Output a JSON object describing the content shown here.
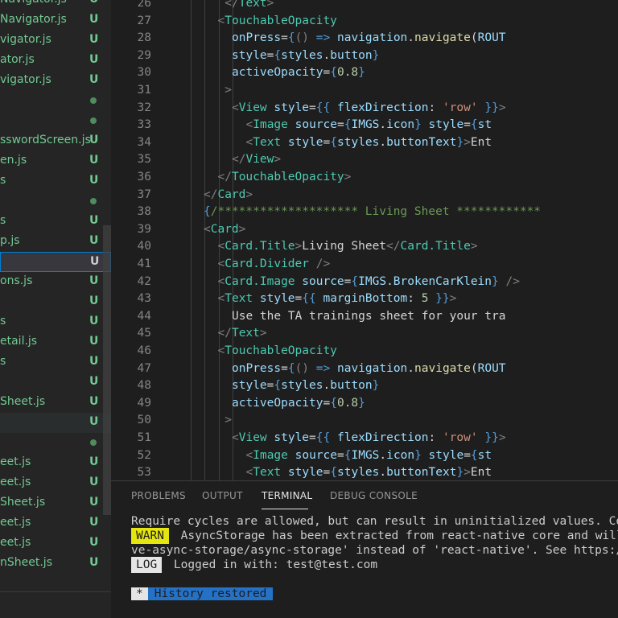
{
  "sidebar": {
    "files": [
      {
        "name": "Navigator.js",
        "badge": "U",
        "tail": "s"
      },
      {
        "name": "Navigator.js",
        "badge": "U"
      },
      {
        "name": "vigator.js",
        "badge": "U"
      },
      {
        "name": "ator.js",
        "badge": "U"
      },
      {
        "name": "vigator.js",
        "badge": "U"
      },
      {
        "name": "",
        "badge": "dot"
      },
      {
        "name": "",
        "badge": "dot"
      },
      {
        "name": "sswordScreen.js",
        "badge": "U"
      },
      {
        "name": "en.js",
        "badge": "U"
      },
      {
        "name": "s",
        "badge": "U"
      },
      {
        "name": "",
        "badge": "dot"
      },
      {
        "name": "s",
        "badge": "U"
      },
      {
        "name": "p.js",
        "badge": "U"
      },
      {
        "name": "",
        "badge": "U",
        "selected": true
      },
      {
        "name": "ons.js",
        "badge": "U"
      },
      {
        "name": "",
        "badge": "U"
      },
      {
        "name": "s",
        "badge": "U"
      },
      {
        "name": "etail.js",
        "badge": "U"
      },
      {
        "name": "s",
        "badge": "U"
      },
      {
        "name": "",
        "badge": "U"
      },
      {
        "name": "Sheet.js",
        "badge": "U"
      },
      {
        "name": "",
        "badge": "U",
        "hover": true
      },
      {
        "name": "",
        "badge": "dot"
      },
      {
        "name": "eet.js",
        "badge": "U"
      },
      {
        "name": "eet.js",
        "badge": "U"
      },
      {
        "name": "Sheet.js",
        "badge": "U"
      },
      {
        "name": "eet.js",
        "badge": "U"
      },
      {
        "name": "eet.js",
        "badge": "U"
      },
      {
        "name": "nSheet.js",
        "badge": "U"
      }
    ]
  },
  "editor": {
    "lines": [
      {
        "n": "26",
        "indent": 7,
        "tokens": [
          [
            "punc",
            "</"
          ],
          [
            "tag",
            "Text"
          ],
          [
            "punc",
            ">"
          ]
        ]
      },
      {
        "n": "27",
        "indent": 6,
        "tokens": [
          [
            "punc",
            "<"
          ],
          [
            "tag",
            "TouchableOpacity"
          ]
        ]
      },
      {
        "n": "28",
        "indent": 8,
        "tokens": [
          [
            "attr",
            "onPress"
          ],
          [
            "text",
            "="
          ],
          [
            "brace",
            "{"
          ],
          [
            "punc",
            "() "
          ],
          [
            "kw",
            "=>"
          ],
          [
            "text",
            " "
          ],
          [
            "attr",
            "navigation"
          ],
          [
            "text",
            "."
          ],
          [
            "fn",
            "navigate"
          ],
          [
            "text",
            "("
          ],
          [
            "attr",
            "ROUT"
          ]
        ]
      },
      {
        "n": "29",
        "indent": 8,
        "tokens": [
          [
            "attr",
            "style"
          ],
          [
            "text",
            "="
          ],
          [
            "brace",
            "{"
          ],
          [
            "attr",
            "styles"
          ],
          [
            "text",
            "."
          ],
          [
            "attr",
            "button"
          ],
          [
            "brace",
            "}"
          ]
        ]
      },
      {
        "n": "30",
        "indent": 8,
        "tokens": [
          [
            "attr",
            "activeOpacity"
          ],
          [
            "text",
            "="
          ],
          [
            "brace",
            "{"
          ],
          [
            "num",
            "0.8"
          ],
          [
            "brace",
            "}"
          ]
        ]
      },
      {
        "n": "31",
        "indent": 7,
        "tokens": [
          [
            "punc",
            ">"
          ]
        ]
      },
      {
        "n": "32",
        "indent": 8,
        "tokens": [
          [
            "punc",
            "<"
          ],
          [
            "tag",
            "View"
          ],
          [
            "text",
            " "
          ],
          [
            "attr",
            "style"
          ],
          [
            "text",
            "="
          ],
          [
            "brace",
            "{{ "
          ],
          [
            "attr",
            "flexDirection"
          ],
          [
            "text",
            ": "
          ],
          [
            "str",
            "'row'"
          ],
          [
            "brace",
            " }}"
          ],
          [
            "punc",
            ">"
          ]
        ]
      },
      {
        "n": "33",
        "indent": 10,
        "tokens": [
          [
            "punc",
            "<"
          ],
          [
            "tag",
            "Image"
          ],
          [
            "text",
            " "
          ],
          [
            "attr",
            "source"
          ],
          [
            "text",
            "="
          ],
          [
            "brace",
            "{"
          ],
          [
            "attr",
            "IMGS"
          ],
          [
            "text",
            "."
          ],
          [
            "attr",
            "icon"
          ],
          [
            "brace",
            "}"
          ],
          [
            "text",
            " "
          ],
          [
            "attr",
            "style"
          ],
          [
            "text",
            "="
          ],
          [
            "brace",
            "{"
          ],
          [
            "attr",
            "st"
          ]
        ]
      },
      {
        "n": "34",
        "indent": 10,
        "tokens": [
          [
            "punc",
            "<"
          ],
          [
            "tag",
            "Text"
          ],
          [
            "text",
            " "
          ],
          [
            "attr",
            "style"
          ],
          [
            "text",
            "="
          ],
          [
            "brace",
            "{"
          ],
          [
            "attr",
            "styles"
          ],
          [
            "text",
            "."
          ],
          [
            "attr",
            "buttonText"
          ],
          [
            "brace",
            "}"
          ],
          [
            "punc",
            ">"
          ],
          [
            "text",
            "Ent"
          ]
        ]
      },
      {
        "n": "35",
        "indent": 8,
        "tokens": [
          [
            "punc",
            "</"
          ],
          [
            "tag",
            "View"
          ],
          [
            "punc",
            ">"
          ]
        ]
      },
      {
        "n": "36",
        "indent": 6,
        "tokens": [
          [
            "punc",
            "</"
          ],
          [
            "tag",
            "TouchableOpacity"
          ],
          [
            "punc",
            ">"
          ]
        ]
      },
      {
        "n": "37",
        "indent": 4,
        "tokens": [
          [
            "punc",
            "</"
          ],
          [
            "tag",
            "Card"
          ],
          [
            "punc",
            ">"
          ]
        ]
      },
      {
        "n": "38",
        "indent": 4,
        "tokens": [
          [
            "brace",
            "{"
          ],
          [
            "cmt",
            "/******************** Living Sheet ************"
          ]
        ]
      },
      {
        "n": "39",
        "indent": 4,
        "tokens": [
          [
            "punc",
            "<"
          ],
          [
            "tag",
            "Card"
          ],
          [
            "punc",
            ">"
          ]
        ]
      },
      {
        "n": "40",
        "indent": 6,
        "tokens": [
          [
            "punc",
            "<"
          ],
          [
            "tag",
            "Card.Title"
          ],
          [
            "punc",
            ">"
          ],
          [
            "text",
            "Living Sheet"
          ],
          [
            "punc",
            "</"
          ],
          [
            "tag",
            "Card.Title"
          ],
          [
            "punc",
            ">"
          ]
        ]
      },
      {
        "n": "41",
        "indent": 6,
        "tokens": [
          [
            "punc",
            "<"
          ],
          [
            "tag",
            "Card.Divider"
          ],
          [
            "text",
            " "
          ],
          [
            "punc",
            "/>"
          ]
        ]
      },
      {
        "n": "42",
        "indent": 6,
        "tokens": [
          [
            "punc",
            "<"
          ],
          [
            "tag",
            "Card.Image"
          ],
          [
            "text",
            " "
          ],
          [
            "attr",
            "source"
          ],
          [
            "text",
            "="
          ],
          [
            "brace",
            "{"
          ],
          [
            "attr",
            "IMGS"
          ],
          [
            "text",
            "."
          ],
          [
            "attr",
            "BrokenCarKlein"
          ],
          [
            "brace",
            "}"
          ],
          [
            "text",
            " "
          ],
          [
            "punc",
            "/>"
          ]
        ]
      },
      {
        "n": "43",
        "indent": 6,
        "tokens": [
          [
            "punc",
            "<"
          ],
          [
            "tag",
            "Text"
          ],
          [
            "text",
            " "
          ],
          [
            "attr",
            "style"
          ],
          [
            "text",
            "="
          ],
          [
            "brace",
            "{{ "
          ],
          [
            "attr",
            "marginBottom"
          ],
          [
            "text",
            ": "
          ],
          [
            "num",
            "5"
          ],
          [
            "brace",
            " }}"
          ],
          [
            "punc",
            ">"
          ]
        ]
      },
      {
        "n": "44",
        "indent": 8,
        "tokens": [
          [
            "text",
            "Use the TA trainings sheet for your tra"
          ]
        ]
      },
      {
        "n": "45",
        "indent": 6,
        "tokens": [
          [
            "punc",
            "</"
          ],
          [
            "tag",
            "Text"
          ],
          [
            "punc",
            ">"
          ]
        ]
      },
      {
        "n": "46",
        "indent": 6,
        "tokens": [
          [
            "punc",
            "<"
          ],
          [
            "tag",
            "TouchableOpacity"
          ]
        ]
      },
      {
        "n": "47",
        "indent": 8,
        "tokens": [
          [
            "attr",
            "onPress"
          ],
          [
            "text",
            "="
          ],
          [
            "brace",
            "{"
          ],
          [
            "punc",
            "() "
          ],
          [
            "kw",
            "=>"
          ],
          [
            "text",
            " "
          ],
          [
            "attr",
            "navigation"
          ],
          [
            "text",
            "."
          ],
          [
            "fn",
            "navigate"
          ],
          [
            "text",
            "("
          ],
          [
            "attr",
            "ROUT"
          ]
        ]
      },
      {
        "n": "48",
        "indent": 8,
        "tokens": [
          [
            "attr",
            "style"
          ],
          [
            "text",
            "="
          ],
          [
            "brace",
            "{"
          ],
          [
            "attr",
            "styles"
          ],
          [
            "text",
            "."
          ],
          [
            "attr",
            "button"
          ],
          [
            "brace",
            "}"
          ]
        ]
      },
      {
        "n": "49",
        "indent": 8,
        "tokens": [
          [
            "attr",
            "activeOpacity"
          ],
          [
            "text",
            "="
          ],
          [
            "brace",
            "{"
          ],
          [
            "num",
            "0.8"
          ],
          [
            "brace",
            "}"
          ]
        ]
      },
      {
        "n": "50",
        "indent": 7,
        "tokens": [
          [
            "punc",
            ">"
          ]
        ]
      },
      {
        "n": "51",
        "indent": 8,
        "tokens": [
          [
            "punc",
            "<"
          ],
          [
            "tag",
            "View"
          ],
          [
            "text",
            " "
          ],
          [
            "attr",
            "style"
          ],
          [
            "text",
            "="
          ],
          [
            "brace",
            "{{ "
          ],
          [
            "attr",
            "flexDirection"
          ],
          [
            "text",
            ": "
          ],
          [
            "str",
            "'row'"
          ],
          [
            "brace",
            " }}"
          ],
          [
            "punc",
            ">"
          ]
        ]
      },
      {
        "n": "52",
        "indent": 10,
        "tokens": [
          [
            "punc",
            "<"
          ],
          [
            "tag",
            "Image"
          ],
          [
            "text",
            " "
          ],
          [
            "attr",
            "source"
          ],
          [
            "text",
            "="
          ],
          [
            "brace",
            "{"
          ],
          [
            "attr",
            "IMGS"
          ],
          [
            "text",
            "."
          ],
          [
            "attr",
            "icon"
          ],
          [
            "brace",
            "}"
          ],
          [
            "text",
            " "
          ],
          [
            "attr",
            "style"
          ],
          [
            "text",
            "="
          ],
          [
            "brace",
            "{"
          ],
          [
            "attr",
            "st"
          ]
        ]
      },
      {
        "n": "53",
        "indent": 10,
        "tokens": [
          [
            "punc",
            "<"
          ],
          [
            "tag",
            "Text"
          ],
          [
            "text",
            " "
          ],
          [
            "attr",
            "style"
          ],
          [
            "text",
            "="
          ],
          [
            "brace",
            "{"
          ],
          [
            "attr",
            "styles"
          ],
          [
            "text",
            "."
          ],
          [
            "attr",
            "buttonText"
          ],
          [
            "brace",
            "}"
          ],
          [
            "punc",
            ">"
          ],
          [
            "text",
            "Ent"
          ]
        ]
      }
    ]
  },
  "panel": {
    "tabs": [
      "PROBLEMS",
      "OUTPUT",
      "TERMINAL",
      "DEBUG CONSOLE"
    ],
    "active_tab": "TERMINAL",
    "terminal": {
      "line1": "Require cycles are allowed, but can result in uninitialized values. Consid",
      "warn_badge": "WARN",
      "line2": " AsyncStorage has been extracted from react-native core and will be",
      "line3": "ve-async-storage/async-storage' instead of 'react-native'. See https://git",
      "log_badge": "LOG",
      "line4": " Logged in with: test@test.com",
      "hist_star": "*",
      "hist_text": "History restored"
    }
  },
  "colors": {
    "file_modified": "#73c991",
    "selection_border": "#007fd4",
    "warn_bg": "#e5e510",
    "history_bg": "#2472c8"
  }
}
